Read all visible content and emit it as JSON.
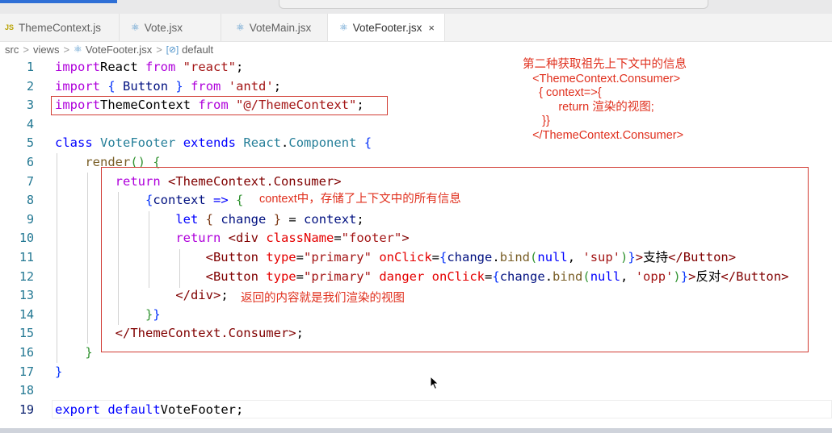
{
  "tabs": [
    {
      "label": "ThemeContext.js",
      "icon": "js-file-icon",
      "active": false
    },
    {
      "label": "Vote.jsx",
      "icon": "react-file-icon",
      "active": false
    },
    {
      "label": "VoteMain.jsx",
      "icon": "react-file-icon",
      "active": false
    },
    {
      "label": "VoteFooter.jsx",
      "icon": "react-file-icon",
      "active": true,
      "close": "×"
    }
  ],
  "breadcrumb": {
    "parts": [
      "src",
      "views",
      "VoteFooter.jsx",
      "default"
    ],
    "separator": ">"
  },
  "editor": {
    "line_numbers": [
      "1",
      "2",
      "3",
      "4",
      "5",
      "6",
      "7",
      "8",
      "9",
      "10",
      "11",
      "12",
      "13",
      "14",
      "15",
      "16",
      "17",
      "18",
      "19"
    ],
    "current_line": "19",
    "lines": [
      [
        [
          "kw2",
          "import"
        ],
        [
          "",
          "React "
        ],
        [
          "kw2",
          "from"
        ],
        [
          "",
          ""
        ],
        [
          "str",
          "\"react\""
        ],
        [
          "",
          ";"
        ]
      ],
      [
        [
          "kw2",
          "import"
        ],
        [
          "",
          ""
        ],
        [
          "br1",
          "{"
        ],
        [
          "",
          ""
        ],
        [
          "var",
          "Button"
        ],
        [
          "",
          ""
        ],
        [
          "br1",
          "}"
        ],
        [
          "",
          ""
        ],
        [
          "kw2",
          "from"
        ],
        [
          "",
          ""
        ],
        [
          "str",
          "'antd'"
        ],
        [
          "",
          ";"
        ]
      ],
      [
        [
          "kw2",
          "import"
        ],
        [
          "",
          "ThemeContext "
        ],
        [
          "kw2",
          "from"
        ],
        [
          "",
          ""
        ],
        [
          "str",
          "\"@/ThemeContext\""
        ],
        [
          "",
          ";"
        ]
      ],
      [],
      [
        [
          "kw",
          "class"
        ],
        [
          "",
          ""
        ],
        [
          "cls",
          "VoteFooter"
        ],
        [
          "",
          ""
        ],
        [
          "kw",
          "extends"
        ],
        [
          "",
          ""
        ],
        [
          "cls",
          "React"
        ],
        [
          "",
          "."
        ],
        [
          "cls",
          "Component"
        ],
        [
          "",
          ""
        ],
        [
          "br1",
          "{"
        ]
      ],
      [
        [
          "",
          "    "
        ],
        [
          "fn",
          "render"
        ],
        [
          "br2",
          "()"
        ],
        [
          "",
          ""
        ],
        [
          "br2",
          "{"
        ]
      ],
      [
        [
          "",
          "        "
        ],
        [
          "kw2",
          "return"
        ],
        [
          "",
          ""
        ],
        [
          "tag",
          "<ThemeContext.Consumer>"
        ]
      ],
      [
        [
          "",
          "            "
        ],
        [
          "br1",
          "{"
        ],
        [
          "var",
          "context"
        ],
        [
          "",
          ""
        ],
        [
          "kw",
          "=>"
        ],
        [
          "",
          ""
        ],
        [
          "br2",
          "{"
        ]
      ],
      [
        [
          "",
          "                "
        ],
        [
          "kw",
          "let"
        ],
        [
          "",
          ""
        ],
        [
          "br3",
          "{"
        ],
        [
          "",
          ""
        ],
        [
          "var",
          "change"
        ],
        [
          "",
          ""
        ],
        [
          "br3",
          "}"
        ],
        [
          "",
          " = "
        ],
        [
          "var",
          "context"
        ],
        [
          "",
          ";"
        ]
      ],
      [
        [
          "",
          "                "
        ],
        [
          "kw2",
          "return"
        ],
        [
          "",
          ""
        ],
        [
          "tag",
          "<div"
        ],
        [
          "",
          ""
        ],
        [
          "attr",
          "className"
        ],
        [
          "",
          "="
        ],
        [
          "str",
          "\"footer\""
        ],
        [
          "tag",
          ">"
        ]
      ],
      [
        [
          "",
          "                    "
        ],
        [
          "tag",
          "<Button"
        ],
        [
          "",
          ""
        ],
        [
          "attr",
          "type"
        ],
        [
          "",
          "="
        ],
        [
          "str",
          "\"primary\""
        ],
        [
          "",
          ""
        ],
        [
          "attr",
          "onClick"
        ],
        [
          "",
          "="
        ],
        [
          "br1",
          "{"
        ],
        [
          "var",
          "change"
        ],
        [
          "",
          "."
        ],
        [
          "fn",
          "bind"
        ],
        [
          "br2",
          "("
        ],
        [
          "lit",
          "null"
        ],
        [
          "",
          ", "
        ],
        [
          "str",
          "'sup'"
        ],
        [
          "br2",
          ")"
        ],
        [
          "br1",
          "}"
        ],
        [
          "tag",
          ">"
        ],
        [
          "",
          "支持"
        ],
        [
          "tag",
          "</Button>"
        ]
      ],
      [
        [
          "",
          "                    "
        ],
        [
          "tag",
          "<Button"
        ],
        [
          "",
          ""
        ],
        [
          "attr",
          "type"
        ],
        [
          "",
          "="
        ],
        [
          "str",
          "\"primary\""
        ],
        [
          "",
          ""
        ],
        [
          "attr",
          "danger"
        ],
        [
          "",
          ""
        ],
        [
          "attr",
          "onClick"
        ],
        [
          "",
          "="
        ],
        [
          "br1",
          "{"
        ],
        [
          "var",
          "change"
        ],
        [
          "",
          "."
        ],
        [
          "fn",
          "bind"
        ],
        [
          "br2",
          "("
        ],
        [
          "lit",
          "null"
        ],
        [
          "",
          ", "
        ],
        [
          "str",
          "'opp'"
        ],
        [
          "br2",
          ")"
        ],
        [
          "br1",
          "}"
        ],
        [
          "tag",
          ">"
        ],
        [
          "",
          "反对"
        ],
        [
          "tag",
          "</Button>"
        ]
      ],
      [
        [
          "",
          "                "
        ],
        [
          "tag",
          "</div>"
        ],
        [
          "",
          ";"
        ]
      ],
      [
        [
          "",
          "            "
        ],
        [
          "br2",
          "}"
        ],
        [
          "br1",
          "}"
        ]
      ],
      [
        [
          "",
          "        "
        ],
        [
          "tag",
          "</ThemeContext.Consumer>"
        ],
        [
          "",
          ";"
        ]
      ],
      [
        [
          "",
          "    "
        ],
        [
          "br2",
          "}"
        ]
      ],
      [
        [
          "br1",
          "}"
        ]
      ],
      [],
      [
        [
          "kw",
          "export"
        ],
        [
          "",
          ""
        ],
        [
          "kw",
          "default"
        ],
        [
          "",
          "VoteFooter;"
        ]
      ]
    ]
  },
  "annotations": {
    "top_right": "第二种获取祖先上下文中的信息\n   <ThemeContext.Consumer>\n     { context=>{\n           return 渲染的视图;\n      }}\n   </ThemeContext.Consumer>",
    "context_note": "context中，存储了上下文中的所有信息",
    "return_note": "返回的内容就是我们渲染的视图"
  },
  "colors": {
    "annotation_red": "#e0301e",
    "box_red": "#d13b33",
    "line_number": "#237893",
    "keyword": "#0000ff",
    "control_keyword": "#af00db",
    "string": "#a31515",
    "jsx_tag": "#800000"
  }
}
